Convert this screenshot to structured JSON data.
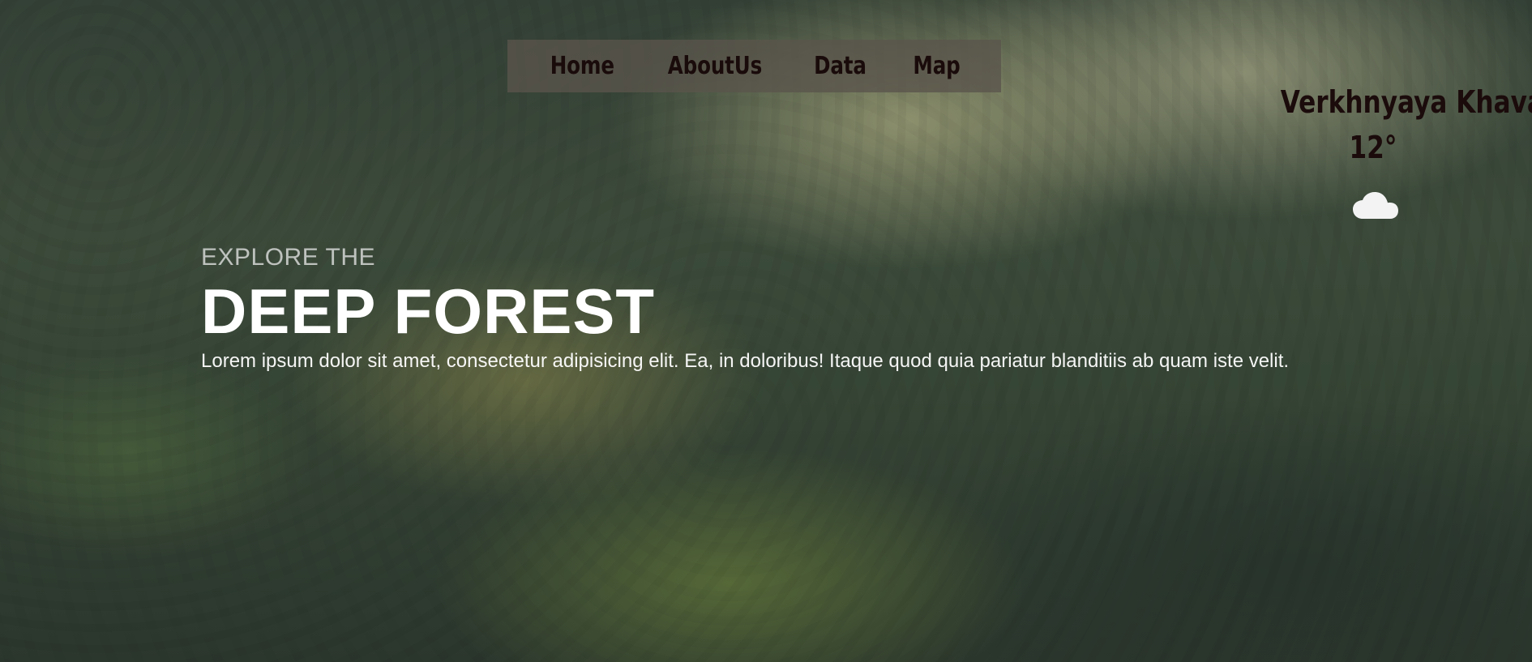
{
  "nav": {
    "items": [
      {
        "label": "Home"
      },
      {
        "label": "AboutUs"
      },
      {
        "label": "Data"
      },
      {
        "label": "Map"
      }
    ]
  },
  "weather": {
    "city": "Verkhnyaya Khava",
    "temperature": "12°",
    "icon": "cloud-icon"
  },
  "hero": {
    "kicker": "EXPLORE THE",
    "title": "DEEP FOREST",
    "description": "Lorem ipsum dolor sit amet, consectetur adipisicing elit. Ea, in doloribus! Itaque quod quia pariatur blanditiis ab quam iste velit."
  },
  "colors": {
    "nav_text": "#1a0b0b",
    "weather_text": "#1b0b0b",
    "hero_text": "#ffffff"
  }
}
